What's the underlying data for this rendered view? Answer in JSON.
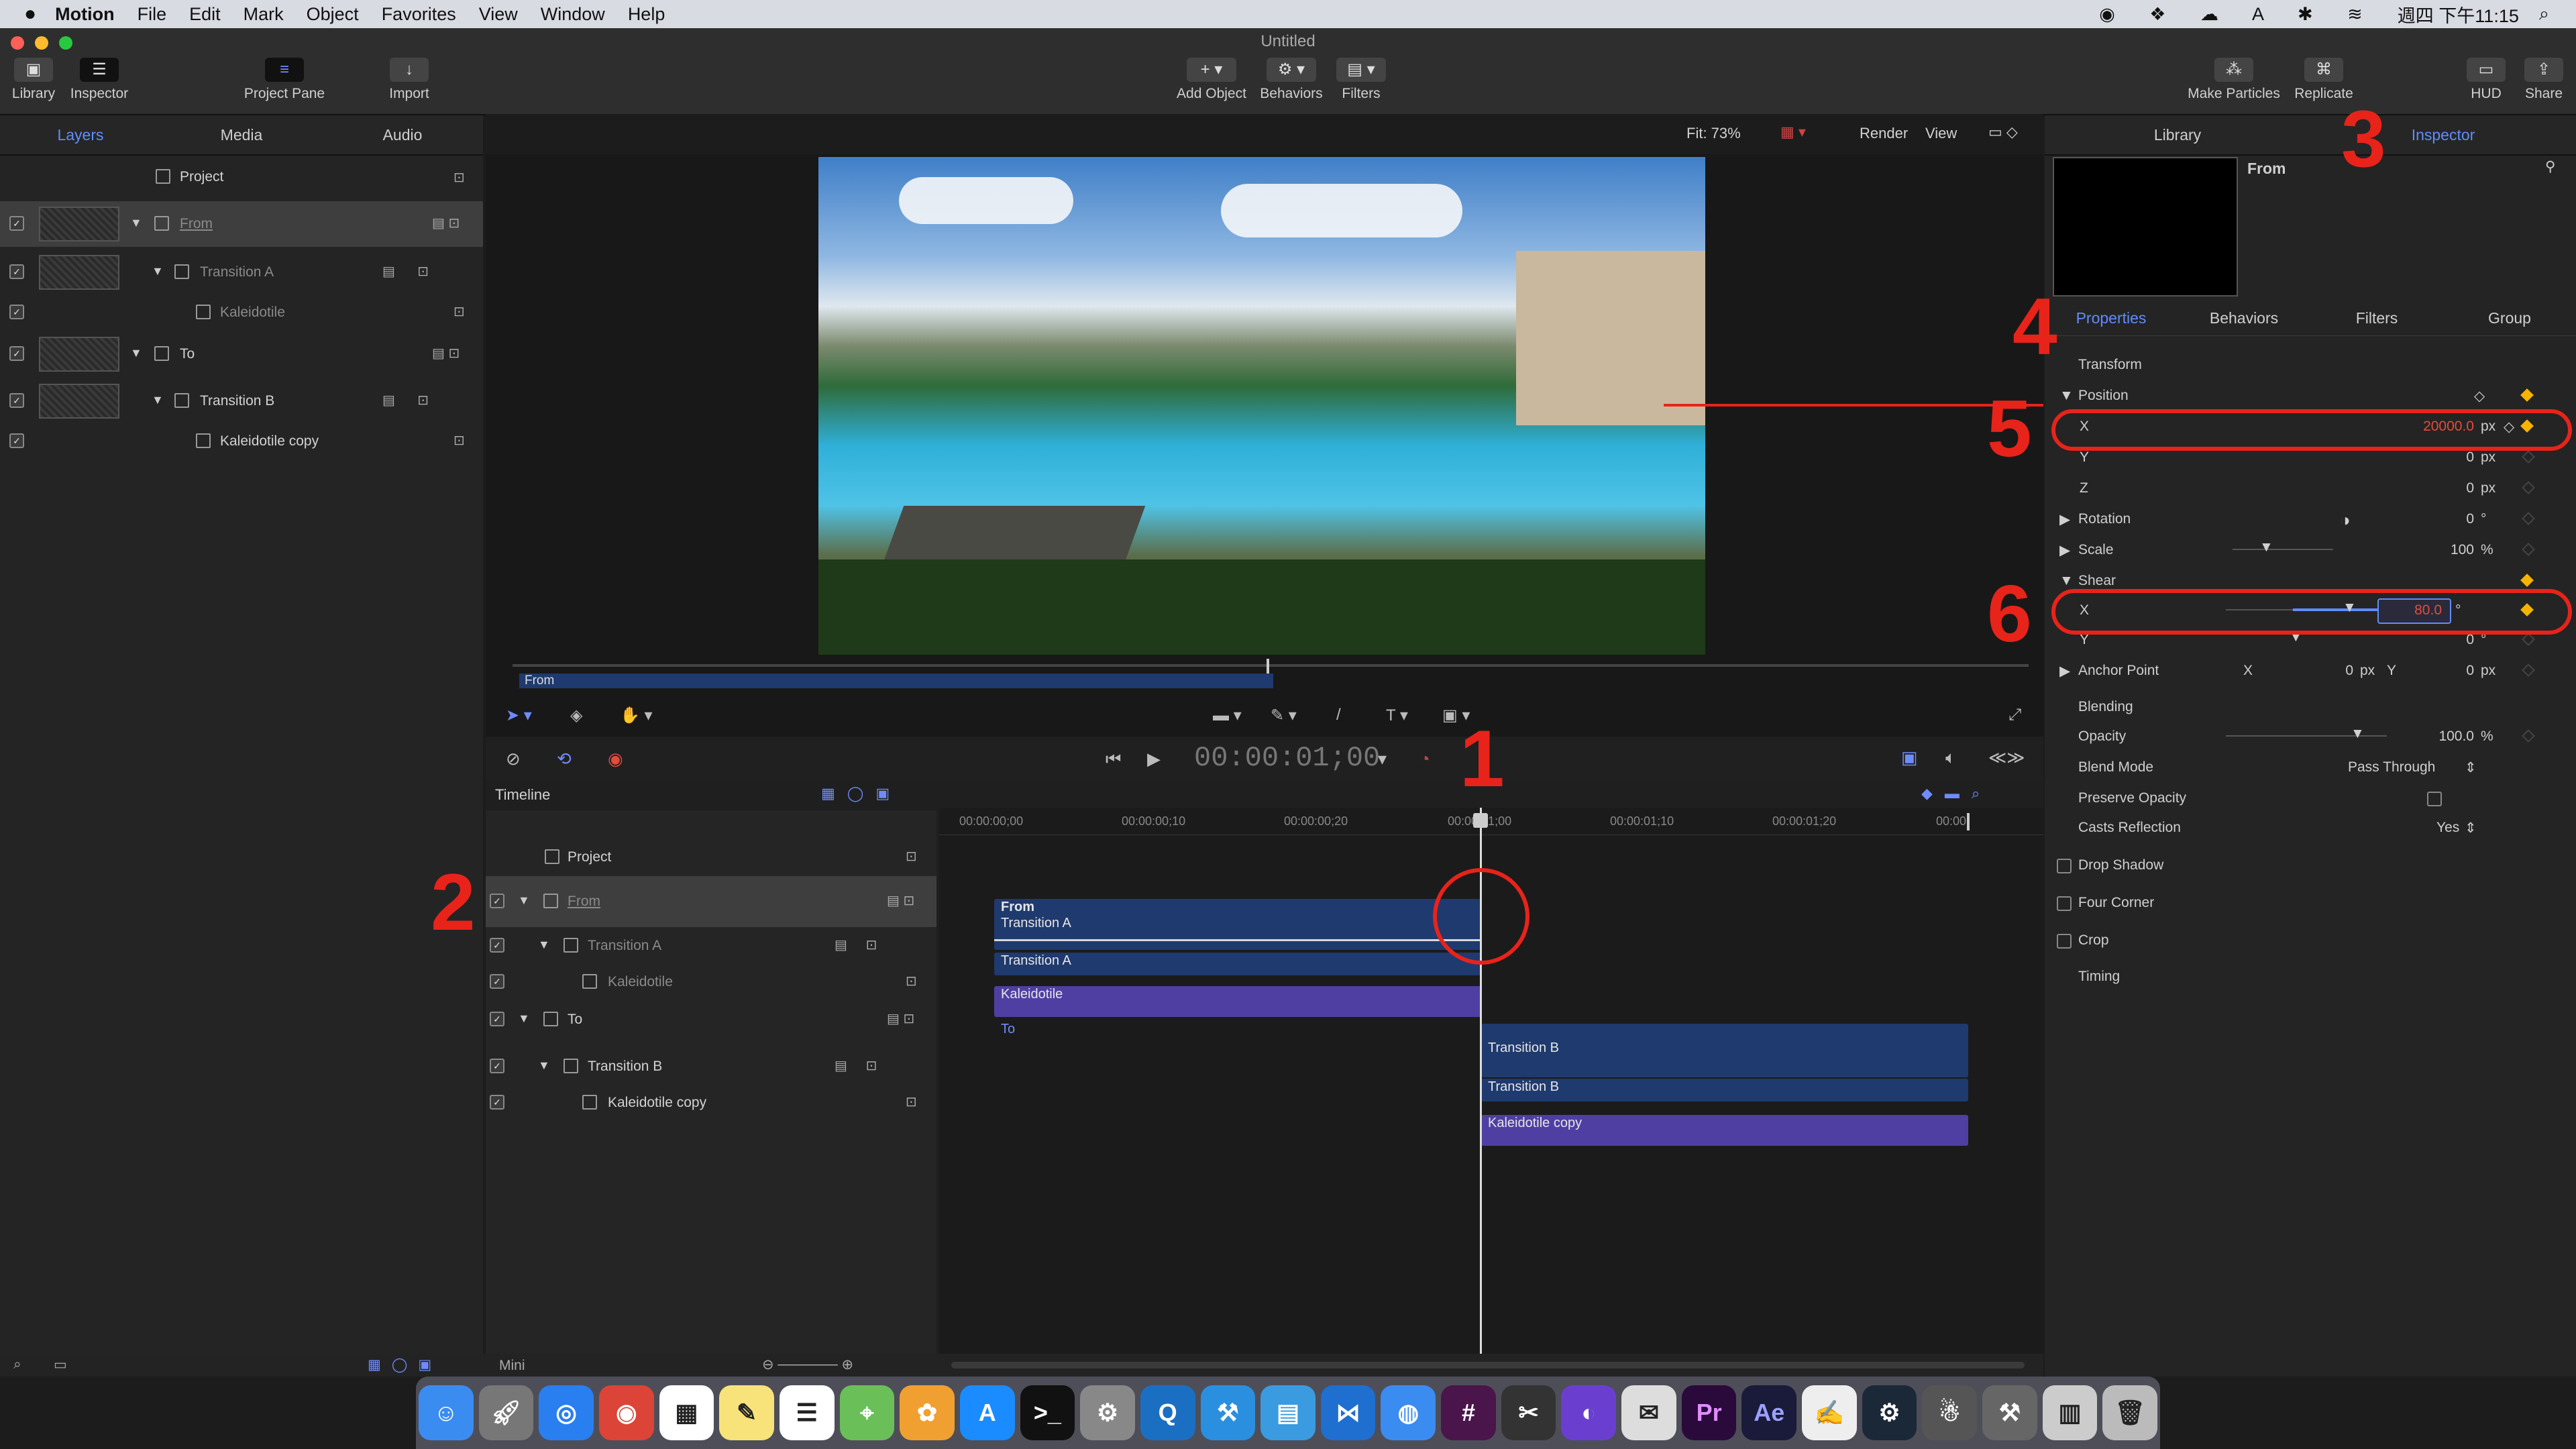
{
  "menubar": {
    "app": "Motion",
    "items": [
      "File",
      "Edit",
      "Mark",
      "Object",
      "Favorites",
      "View",
      "Window",
      "Help"
    ],
    "clock": "週四 下午11:15"
  },
  "window": {
    "title": "Untitled"
  },
  "toolbar": {
    "library": "Library",
    "inspector": "Inspector",
    "project_pane": "Project Pane",
    "import": "Import",
    "add_object": "Add Object",
    "behaviors": "Behaviors",
    "filters": "Filters",
    "make_particles": "Make Particles",
    "replicate": "Replicate",
    "hud": "HUD",
    "share": "Share"
  },
  "left_tabs": [
    "Layers",
    "Media",
    "Audio"
  ],
  "layers": {
    "project": "Project",
    "items": [
      {
        "name": "From",
        "indent": 0,
        "thumb": true
      },
      {
        "name": "Transition A",
        "indent": 1,
        "thumb": true
      },
      {
        "name": "Kaleidotile",
        "indent": 2,
        "thumb": false
      },
      {
        "name": "To",
        "indent": 0,
        "thumb": true
      },
      {
        "name": "Transition B",
        "indent": 1,
        "thumb": true
      },
      {
        "name": "Kaleidotile copy",
        "indent": 2,
        "thumb": false
      }
    ]
  },
  "canvas_bar": {
    "fit": "Fit: 73%",
    "render": "Render",
    "view": "View"
  },
  "mini_timeline": {
    "label": "From"
  },
  "transport": {
    "timecode": "00:00:01;00"
  },
  "timeline": {
    "label": "Timeline",
    "ruler": [
      "00:00:00;00",
      "00:00:00;10",
      "00:00:00;20",
      "00:00:01;00",
      "00:00:01;10",
      "00:00:01;20",
      "00:00:"
    ],
    "rows": [
      "Project",
      "From",
      "Transition A",
      "Kaleidotile",
      "To",
      "Transition B",
      "Kaleidotile copy"
    ],
    "bars": {
      "from": "From",
      "from_sub": "Transition A",
      "trans_a": "Transition A",
      "kaleido": "Kaleidotile",
      "to": "To",
      "trans_b1": "Transition B",
      "trans_b2": "Transition B",
      "kaleido_copy": "Kaleidotile copy"
    }
  },
  "bottom": {
    "mini": "Mini"
  },
  "right_tabs": [
    "Library",
    "Inspector"
  ],
  "inspector": {
    "preview_name": "From",
    "tabs": [
      "Properties",
      "Behaviors",
      "Filters",
      "Group"
    ],
    "transform": "Transform",
    "position": "Position",
    "pos_x_label": "X",
    "pos_x": "20000.0",
    "px": "px",
    "pos_y_label": "Y",
    "pos_y": "0",
    "pos_z_label": "Z",
    "pos_z": "0",
    "rotation": "Rotation",
    "rotation_val": "0",
    "deg": "°",
    "scale": "Scale",
    "scale_val": "100",
    "pct": "%",
    "shear": "Shear",
    "shear_x_label": "X",
    "shear_x": "80.0",
    "shear_y_label": "Y",
    "shear_y": "0",
    "anchor": "Anchor Point",
    "anchor_x_label": "X",
    "anchor_x": "0",
    "anchor_y_label": "Y",
    "anchor_y": "0",
    "blending": "Blending",
    "opacity": "Opacity",
    "opacity_val": "100.0",
    "blend_mode": "Blend Mode",
    "blend_mode_val": "Pass Through",
    "preserve_opacity": "Preserve Opacity",
    "casts_reflection": "Casts Reflection",
    "casts_reflection_val": "Yes",
    "drop_shadow": "Drop Shadow",
    "four_corner": "Four Corner",
    "crop": "Crop",
    "timing": "Timing"
  },
  "annotations": [
    "1",
    "2",
    "3",
    "4",
    "5",
    "6"
  ],
  "colors": {
    "accent": "#5f8cff",
    "annotation": "#e8231a",
    "keyframe": "#f6b400",
    "bar_blue": "#1f3a6e",
    "bar_purple": "#4f3fa3"
  }
}
